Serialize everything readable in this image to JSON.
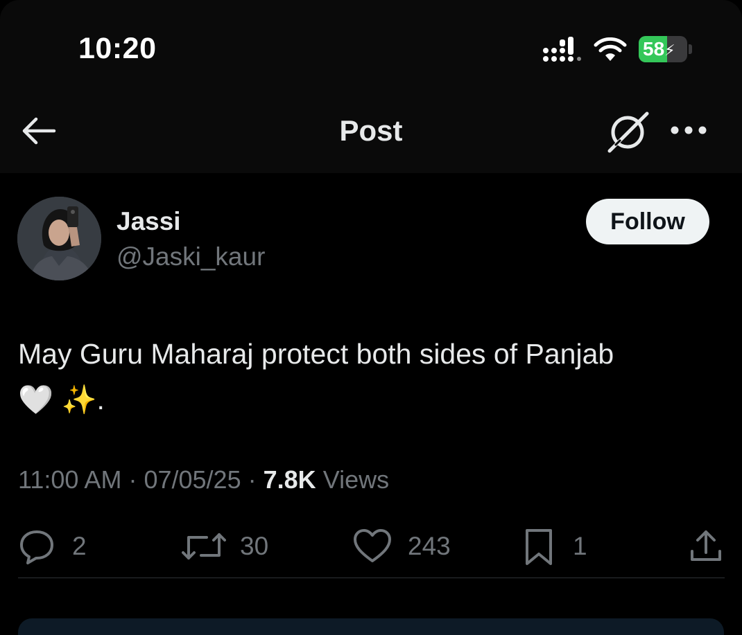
{
  "status_bar": {
    "time": "10:20",
    "battery": {
      "percent": 58,
      "label": "58",
      "charging": true
    }
  },
  "nav": {
    "title": "Post",
    "back_icon": "arrow-left-icon",
    "grok_icon": "grok-icon",
    "more_icon": "more-horizontal-icon"
  },
  "author": {
    "name": "Jassi",
    "handle": "@Jaski_kaur",
    "follow_label": "Follow"
  },
  "post": {
    "text": "May Guru Maharaj protect both sides of Panjab",
    "emoji_heart": "🤍",
    "emoji_sparkles": "✨",
    "emoji_trail": ".",
    "time": "11:00 AM",
    "date": "07/05/25",
    "views_count": "7.8K",
    "views_label": "Views"
  },
  "actions": {
    "replies": "2",
    "reposts": "30",
    "likes": "243",
    "bookmarks": "1"
  },
  "colors": {
    "background": "#000000",
    "text": "#e7e9ea",
    "muted": "#71767b",
    "battery_green": "#34c759"
  }
}
